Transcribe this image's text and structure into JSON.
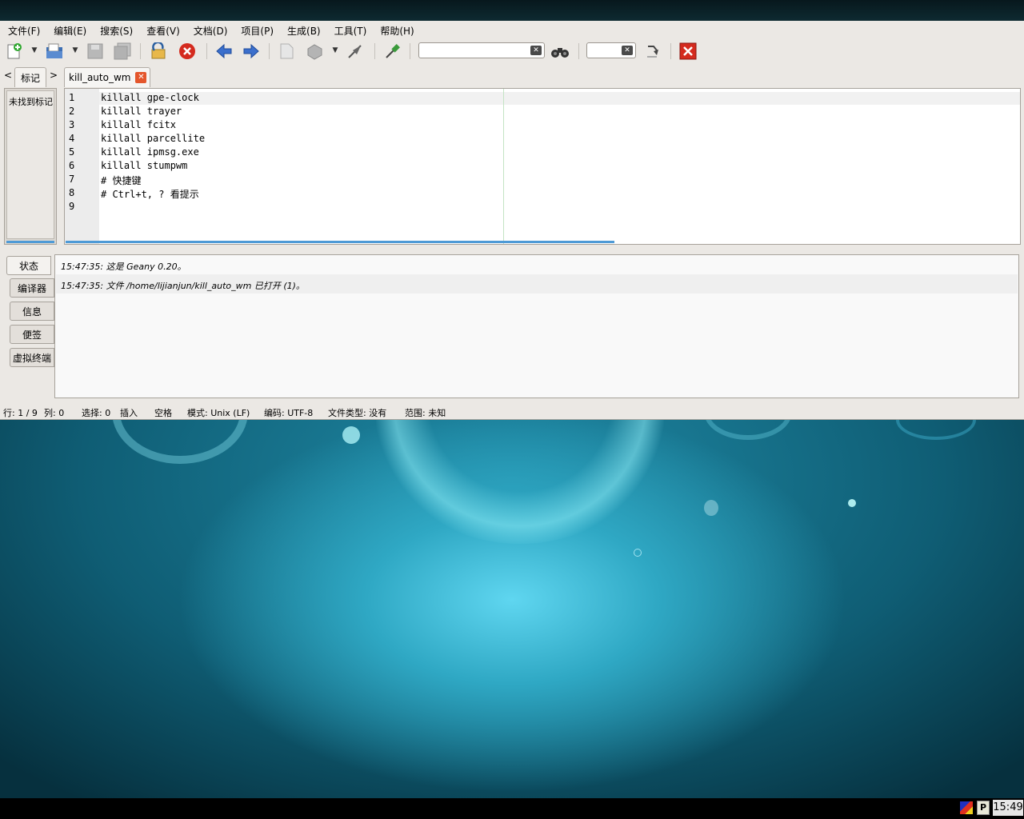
{
  "menubar": {
    "items": [
      "文件(F)",
      "编辑(E)",
      "搜索(S)",
      "查看(V)",
      "文档(D)",
      "项目(P)",
      "生成(B)",
      "工具(T)",
      "帮助(H)"
    ]
  },
  "toolbar": {
    "search_value": "",
    "goto_line_value": "",
    "clear_glyph": "✕"
  },
  "sidebar": {
    "nav_prev": "<",
    "nav_next": ">",
    "tab_label": "标记",
    "empty_text": "未找到标记"
  },
  "document": {
    "tab_label": "kill_auto_wm",
    "close_glyph": "✕",
    "line_numbers": [
      "1",
      "2",
      "3",
      "4",
      "5",
      "6",
      "7",
      "8",
      "9"
    ],
    "lines": [
      "killall gpe-clock",
      "killall trayer",
      "killall fcitx",
      "killall parcellite",
      "killall ipmsg.exe",
      "killall stumpwm",
      "# 快捷键",
      "# Ctrl+t, ? 看提示",
      ""
    ]
  },
  "messages": {
    "tabs": [
      "状态",
      "编译器",
      "信息",
      "便签",
      "虚拟终端"
    ],
    "active_tab": "状态",
    "lines": [
      "15:47:35: 这是 Geany 0.20。",
      "15:47:35: 文件 /home/lijianjun/kill_auto_wm 已打开 (1)。"
    ]
  },
  "statusbar": {
    "line": "行: 1 / 9",
    "col": "列: 0",
    "selection": "选择: 0",
    "insert_mode": "插入",
    "indent": "空格",
    "eol_mode": "模式: Unix (LF)",
    "encoding": "编码: UTF-8",
    "filetype": "文件类型: 没有",
    "scope": "范围: 未知"
  },
  "taskbar": {
    "tray_label": "P",
    "clock": "15:49"
  }
}
